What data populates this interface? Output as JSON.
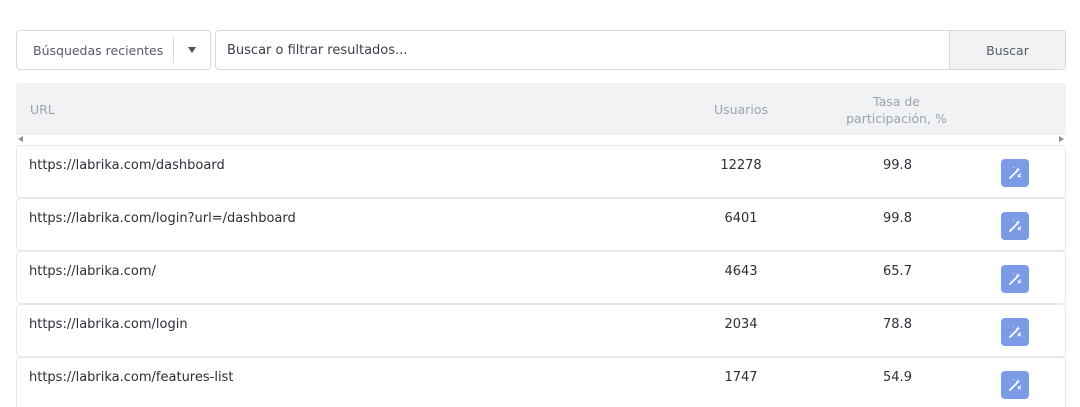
{
  "search": {
    "recent_label": "Búsquedas recientes",
    "placeholder": "Buscar o filtrar resultados...",
    "button_label": "Buscar"
  },
  "table": {
    "headers": {
      "url": "URL",
      "users": "Usuarios",
      "rate_line1": "Tasa de",
      "rate_line2": "participación, %"
    },
    "rows": [
      {
        "url": "https://labrika.com/dashboard",
        "users": "12278",
        "rate": "99.8"
      },
      {
        "url": "https://labrika.com/login?url=/dashboard",
        "users": "6401",
        "rate": "99.8"
      },
      {
        "url": "https://labrika.com/",
        "users": "4643",
        "rate": "65.7"
      },
      {
        "url": "https://labrika.com/login",
        "users": "2034",
        "rate": "78.8"
      },
      {
        "url": "https://labrika.com/features-list",
        "users": "1747",
        "rate": "54.9"
      }
    ]
  },
  "icons": {
    "action": "magic-wand-icon",
    "dropdown": "chevron-down-icon"
  },
  "colors": {
    "action_button": "#7b9be6",
    "header_bg": "#f1f2f4",
    "header_text": "#9aa2b2"
  }
}
